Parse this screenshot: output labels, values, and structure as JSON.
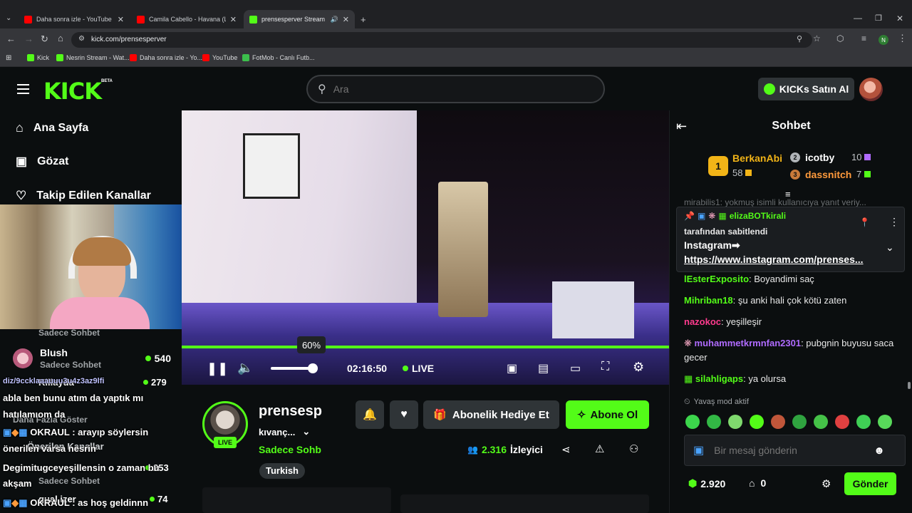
{
  "browser": {
    "tabs": [
      {
        "title": "Daha sonra izle - YouTube",
        "fav_color": "#ff0000"
      },
      {
        "title": "Camila Cabello - Havana (Lyrics",
        "fav_color": "#ff0000"
      },
      {
        "title": "prensesperver Stream - Wa",
        "fav_color": "#53fc18"
      }
    ],
    "url": "kick.com/prensesperver",
    "profile_initial": "N",
    "bookmarks": [
      "Kick",
      "Nesrin Stream - Wat...",
      "Daha sonra izle - Yo...",
      "YouTube",
      "FotMob - Canlı Futb..."
    ]
  },
  "header": {
    "logo": "KICK",
    "logo_badge": "BETA",
    "search_placeholder": "Ara",
    "kicks_label": "KICKs Satın Al"
  },
  "sidebar": {
    "nav": [
      "Ana Sayfa",
      "Gözat",
      "Takip Edilen Kanallar"
    ],
    "channels": [
      {
        "name": "Blush",
        "category": "Sadece Sohbet",
        "viewers": "540"
      },
      {
        "name": "Killayda",
        "category": "Sadece Sohbet",
        "viewers": "279"
      },
      {
        "name": "Daha Fazla Göster"
      },
      {
        "name": "Önerilen Kanallar"
      },
      {
        "name": "Tugce",
        "category": "Sadece Sohbet",
        "viewers": "253"
      },
      {
        "name": "gual.izer",
        "viewers": "74"
      }
    ],
    "top_channel_category": "Sadece Sohbet",
    "overlay_chat": [
      "diz/9ccklaaauuu3u4z3az9lfi",
      "abla ben bunu atım da yaptık mı",
      "hatılamıom da",
      "OKRAUL : arayıp söylersin",
      "önerilen varsa nesrin",
      "Degimitugceyeşillensin o zaman bu",
      "akşam",
      "OKRAUL : as hoş geldinnn"
    ]
  },
  "player": {
    "volume_percent": 60,
    "time": "02:16:50",
    "live_label": "LIVE",
    "progress": 1.0
  },
  "stream_info": {
    "streamer": "prensesp",
    "subtitle": "kıvanç...",
    "category": "Sadece Sohb",
    "tag": "Turkish",
    "live_badge": "LIVE",
    "gift_label": "Abonelik Hediye Et",
    "subscribe_label": "Abone Ol",
    "viewers": "2.316",
    "viewers_label": "İzleyici"
  },
  "chat": {
    "title": "Sohbet",
    "leaderboard": [
      {
        "rank": "1",
        "name": "BerkanAbi",
        "count": "58"
      },
      {
        "rank": "2",
        "name": "icotby",
        "count": "10"
      },
      {
        "rank": "3",
        "name": "dassnitch",
        "count": "7"
      }
    ],
    "truncated_line": "mirabilis1: yokmuş isimli kullanıcıya yanıt veriy...",
    "pinned": {
      "user": "elizaBOTkirali",
      "pinned_by": "tarafından sabitlendi",
      "text": "Instagram➡",
      "link": "https://www.instagram.com/prenses..."
    },
    "messages": [
      {
        "user": "lEsterExposito",
        "color": "#53fc18",
        "text": ": Boyandimi saç"
      },
      {
        "user": "Mihriban18",
        "color": "#53fc18",
        "text": ": şu anki hali çok kötü zaten"
      },
      {
        "user": "nazokoc",
        "color": "#ff3b8e",
        "text": ": yeşilleşir"
      },
      {
        "user": "muhammetkrmnfan2301",
        "color": "#b06bff",
        "text": ": pubgnin buyusu saca gecer"
      },
      {
        "user": "silahligaps",
        "color": "#53fc18",
        "text": ": ya olursa"
      }
    ],
    "slow_mode": "Yavaş mod aktif",
    "input_placeholder": "Bir mesaj gönderin",
    "points": "2.920",
    "store_count": "0",
    "send_label": "Gönder"
  }
}
